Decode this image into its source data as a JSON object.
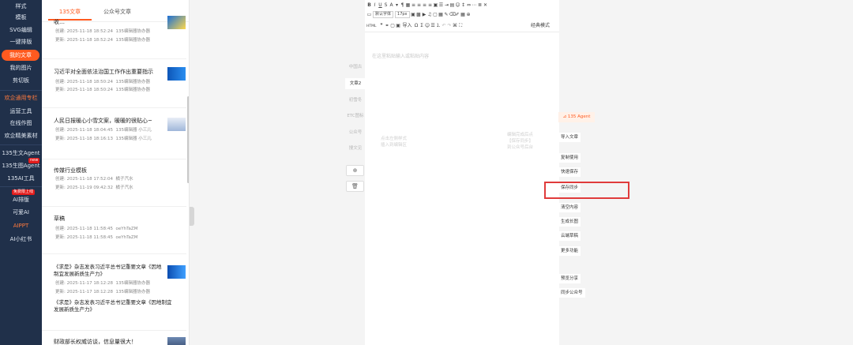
{
  "nav": {
    "items": [
      "样式",
      "模板",
      "SVG编辑",
      "一键排版",
      "我的文章",
      "我的图片",
      "剪切板",
      "欢企通用专栏",
      "运营工具",
      "在线作图",
      "欢企精美素材",
      "135生文Agent",
      "135生图Agent",
      "135AI工具",
      "AI排版",
      "可爱AI",
      "AIPPT",
      "AI小红书"
    ],
    "active": "我的文章",
    "badge_new": "new",
    "badge_promo": "免费限上线"
  },
  "list": {
    "tabs": [
      "135文章",
      "公众号文章"
    ],
    "articles": [
      {
        "title": "收…",
        "created": "创建: 2025-11-18 18:52:24",
        "updated": "更新: 2025-11-18 18:52:24",
        "author": "135编辑器协办器"
      },
      {
        "title": "习近平对全面依法治国工作作出重要指示",
        "created": "创建: 2025-11-18 18:50:24",
        "updated": "更新: 2025-11-18 18:50:24",
        "author": "135编辑器协办器"
      },
      {
        "title": "人民日报暖心小雪文案，暖暖的很贴心~",
        "created": "创建: 2025-11-18 18:04:45",
        "updated": "更新: 2025-11-18 18:16:13",
        "author": "135编辑器 小三儿"
      },
      {
        "title": "传媒行业模板",
        "created": "创建: 2025-11-18 17:52:04",
        "updated": "更新: 2025-11-19 09:42:32",
        "author": "橘子汽水"
      },
      {
        "title": "草稿",
        "created": "创建: 2025-11-18 11:58:45",
        "updated": "更新: 2025-11-18 11:58:45",
        "author": "oeYhTaZM"
      },
      {
        "title": "《求是》杂志发表习近平总书记重要文章《因地制宜发展新质生产力》",
        "created": "创建: 2025-11-17 18:12:28",
        "updated": "更新: 2025-11-17 18:12:28",
        "author": "135编辑器协办器",
        "extra": "《求是》杂志发表习近平总书记重要文章《因地制宜发展新质生产力》"
      },
      {
        "title": "财政部长权威访谈，信息量很大！",
        "created": "",
        "updated": "",
        "author": ""
      }
    ]
  },
  "style_tabs": [
    "中国古",
    "文章2",
    "初雪冬",
    "ETC图标",
    "公众号",
    "搜文见"
  ],
  "editor": {
    "font_family": "默认字体",
    "font_size": "17px",
    "html_label": "HTML",
    "import_label": "导入",
    "mode": "经典模式",
    "placeholder": "在这里粘贴输入或粘贴内容",
    "hint_left": [
      "点击左侧样式",
      "插入到编辑区"
    ],
    "hint_right": [
      "编辑完成后点",
      "【保存同步】",
      "到公众号后台"
    ]
  },
  "actions": {
    "agent": "135 Agent",
    "buttons": [
      "导入文章",
      "复制使用",
      "快速保存",
      "保存同步",
      "清空内容",
      "生成长图",
      "云端草稿",
      "更多功能",
      "预览分享",
      "同步公众号"
    ]
  },
  "colors": {
    "accent": "#ff5a1f",
    "nav_bg": "#20304a",
    "highlight_box": "#e03b3b"
  }
}
